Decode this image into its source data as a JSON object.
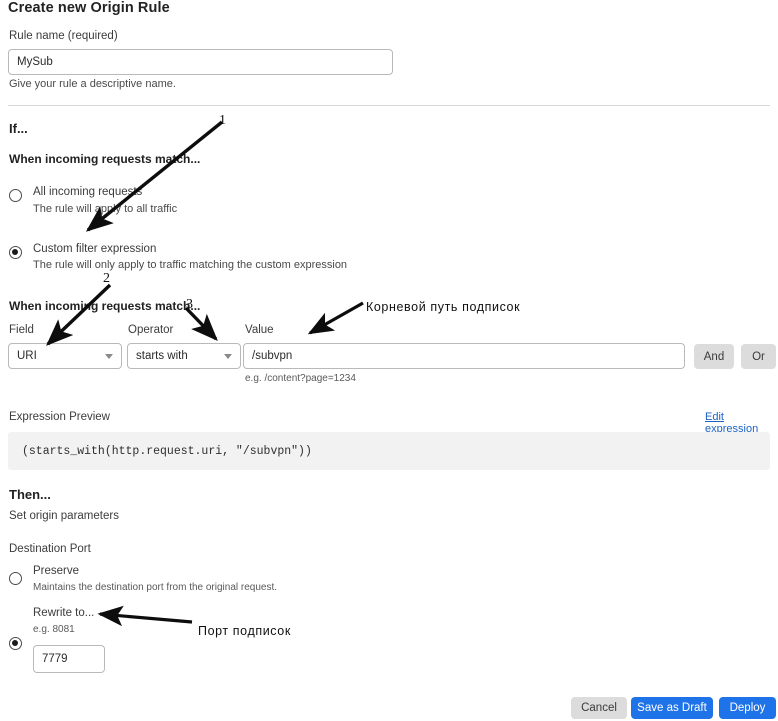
{
  "header": {
    "title": "Create new Origin Rule"
  },
  "rule_name": {
    "label": "Rule name (required)",
    "value": "MySub",
    "placeholder": "Rule name",
    "help": "Give your rule a descriptive name."
  },
  "if_section": {
    "heading": "If...",
    "subheading": "When incoming requests match...",
    "options": [
      {
        "label": "All incoming requests",
        "description": "The rule will apply to all traffic",
        "selected": false
      },
      {
        "label": "Custom filter expression",
        "description": "The rule will only apply to traffic matching the custom expression",
        "selected": true
      }
    ]
  },
  "matcher": {
    "heading": "When incoming requests match...",
    "field": {
      "label": "Field",
      "value": "URI"
    },
    "operator": {
      "label": "Operator",
      "value": "starts with"
    },
    "value": {
      "label": "Value",
      "value": "/subvpn",
      "placeholder": "Value",
      "help": "e.g. /content?page=1234"
    },
    "and_label": "And",
    "or_label": "Or"
  },
  "expression": {
    "label": "Expression Preview",
    "edit_link": "Edit expression",
    "preview": "(starts_with(http.request.uri, \"/subvpn\"))"
  },
  "then_section": {
    "heading": "Then...",
    "subheading": "Set origin parameters",
    "destination_port": {
      "label": "Destination Port",
      "options": [
        {
          "label": "Preserve",
          "description": "Maintains the destination port from the original request.",
          "selected": false
        },
        {
          "label": "Rewrite to...",
          "description": "e.g. 8081",
          "selected": true
        }
      ],
      "port_value": "7779",
      "port_placeholder": "Port"
    }
  },
  "footer": {
    "cancel_label": "Cancel",
    "save_draft_label": "Save as Draft",
    "deploy_label": "Deploy"
  },
  "annotations": {
    "markers": [
      "1",
      "2",
      "3"
    ],
    "notes": [
      "Корневой путь подписок",
      "Порт подписок"
    ]
  },
  "colors": {
    "accent_blue": "#1f73e8",
    "link_blue": "#1a62c4",
    "button_grey": "#dcdcdc",
    "preview_bg": "#f2f2f2"
  }
}
